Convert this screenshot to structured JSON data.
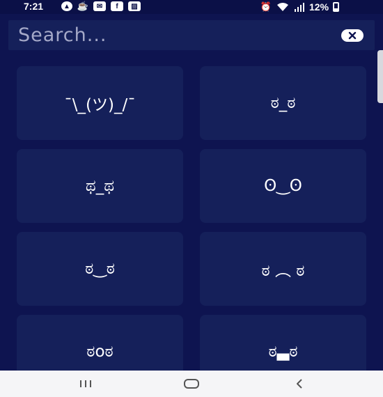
{
  "status_bar": {
    "time": "7:21",
    "battery_percent": "12%",
    "left_icons": [
      "navigation-icon",
      "food-icon",
      "mail-icon",
      "facebook-icon",
      "gallery-icon"
    ],
    "right_icons": [
      "alarm-icon",
      "wifi-icon",
      "signal-icon",
      "battery-icon"
    ]
  },
  "search": {
    "placeholder": "Search...",
    "value": ""
  },
  "emoticons": [
    "¯\\_(ツ)_/¯",
    "ಠ_ಠ",
    "ಥ_ಥ",
    "ʘ‿ʘ",
    "ಠ‿ಠ",
    "ಠ ︵ ಠ",
    "ಠoಠ",
    "ಠ▃ಠ"
  ],
  "colors": {
    "background": "#0e1450",
    "card": "#15205a",
    "text": "#ffffff",
    "nav_bar": "#f5f5f7"
  },
  "nav_bar": {
    "buttons": [
      "recent-apps-icon",
      "home-icon",
      "back-icon"
    ]
  }
}
